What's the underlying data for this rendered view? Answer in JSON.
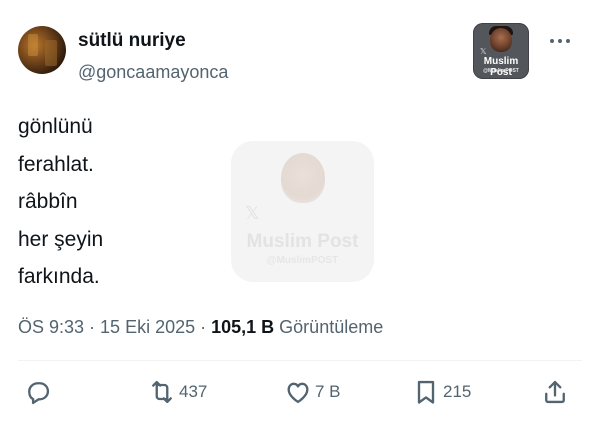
{
  "author": {
    "display_name": "sütlü nuriye",
    "handle": "@goncaamayonca"
  },
  "brand_badge": {
    "name": "Muslim Post",
    "handle": "@MuslimPOST",
    "x_mark": "𝕏"
  },
  "tweet": {
    "lines": [
      "gönlünü",
      "ferahlat.",
      "râbbîn",
      "her şeyin",
      "farkında."
    ]
  },
  "watermark": {
    "name": "Muslim Post",
    "handle": "@MuslimPOST",
    "x_mark": "𝕏"
  },
  "meta": {
    "time": "ÖS 9:33",
    "sep1": " · ",
    "date": "15 Eki 2025",
    "sep2": " · ",
    "views_count": "105,1 B",
    "views_label": " Görüntüleme"
  },
  "actions": {
    "retweets": "437",
    "likes": "7 B",
    "bookmarks": "215"
  },
  "icons": {
    "more": "more-icon",
    "reply": "reply-icon",
    "retweet": "retweet-icon",
    "like": "heart-icon",
    "bookmark": "bookmark-icon",
    "share": "share-icon"
  }
}
